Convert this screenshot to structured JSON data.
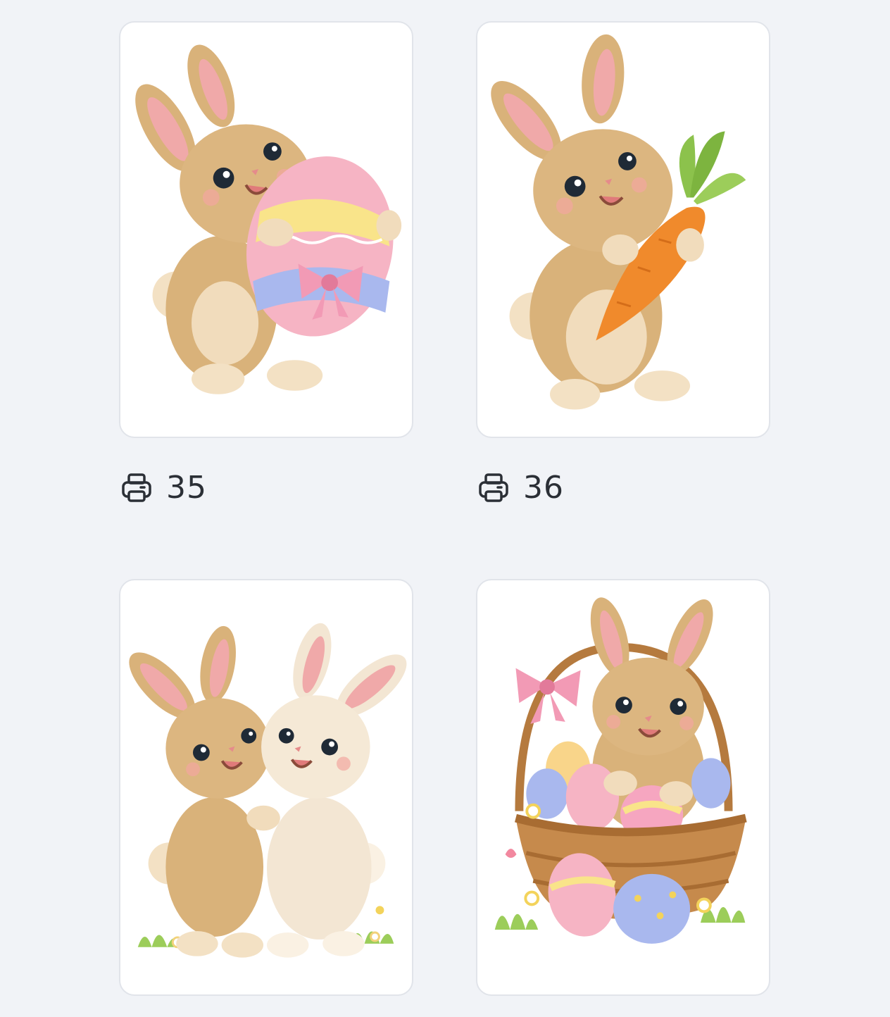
{
  "gallery": {
    "items": [
      {
        "illustration": "bunny-with-easter-egg",
        "icon": "printer-icon",
        "print_count": "35"
      },
      {
        "illustration": "bunny-with-carrot",
        "icon": "printer-icon",
        "print_count": "36"
      },
      {
        "illustration": "two-bunnies-hugging"
      },
      {
        "illustration": "bunny-in-easter-basket"
      }
    ]
  },
  "colors": {
    "background": "#f1f3f7",
    "card": "#ffffff",
    "card_border": "#e1e4ea",
    "text": "#2b2f36",
    "bunny_fur": "#d9b27a",
    "ear_inner": "#f0a9a9",
    "carrot": "#f08a2c",
    "basket": "#b57a3e"
  }
}
